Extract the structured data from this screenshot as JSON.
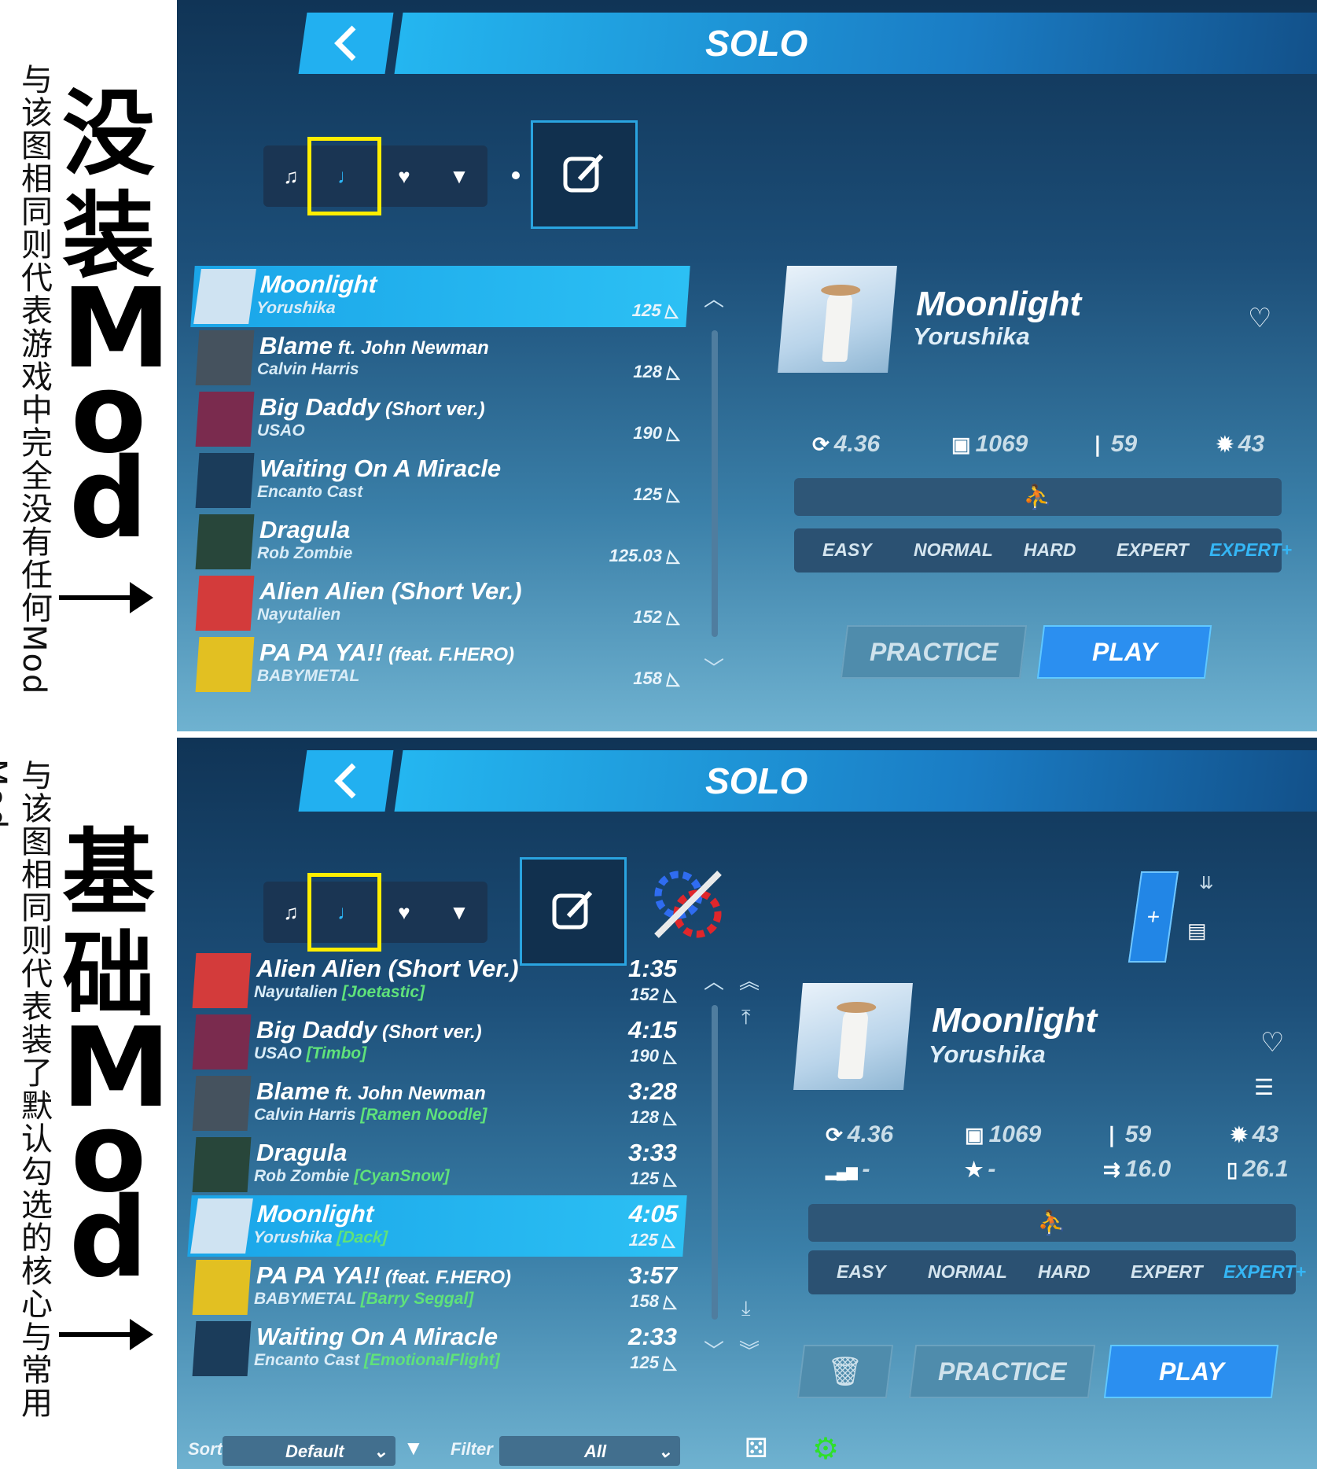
{
  "labels": {
    "top": {
      "small": "与该图相同则代表游戏中完全没有任何Mod",
      "big_cn": [
        "没",
        "装"
      ],
      "big_lat": [
        "M",
        "o",
        "d"
      ]
    },
    "bottom": {
      "small": "与该图相同则代表装了默认勾选的核心与常用Mod",
      "big_cn": [
        "基",
        "础"
      ],
      "big_lat": [
        "M",
        "o",
        "d"
      ]
    }
  },
  "top": {
    "title": "SOLO",
    "songs": [
      {
        "title": "Moonlight",
        "title_sub": "",
        "artist": "Yorushika",
        "bpm": "125",
        "selected": true,
        "cover": "#cfe3f2"
      },
      {
        "title": "Blame",
        "title_sub": " ft. John Newman",
        "artist": "Calvin Harris",
        "bpm": "128",
        "selected": false,
        "cover": "#45525e"
      },
      {
        "title": "Big Daddy",
        "title_sub": " (Short ver.)",
        "artist": "USAO",
        "bpm": "190",
        "selected": false,
        "cover": "#7a2b4e"
      },
      {
        "title": "Waiting On A Miracle",
        "title_sub": "",
        "artist": "Encanto Cast",
        "bpm": "125",
        "selected": false,
        "cover": "#1b3c5a"
      },
      {
        "title": "Dragula",
        "title_sub": "",
        "artist": "Rob Zombie",
        "bpm": "125.03",
        "selected": false,
        "cover": "#28463a"
      },
      {
        "title": "Alien Alien (Short Ver.)",
        "title_sub": "",
        "artist": "Nayutalien",
        "bpm": "152",
        "selected": false,
        "cover": "#d33b3b"
      },
      {
        "title": "PA PA YA!!",
        "title_sub": " (feat. F.HERO)",
        "artist": "BABYMETAL",
        "bpm": "158",
        "selected": false,
        "cover": "#e2c022"
      }
    ],
    "detail": {
      "title": "Moonlight",
      "artist": "Yorushika",
      "stats": [
        {
          "icon": "njs-icon",
          "glyph": "⟳",
          "value": "4.36"
        },
        {
          "icon": "notes-icon",
          "glyph": "▣",
          "value": "1069"
        },
        {
          "icon": "walls-icon",
          "glyph": "❘",
          "value": "59"
        },
        {
          "icon": "bombs-icon",
          "glyph": "✹",
          "value": "43"
        }
      ],
      "difficulties": [
        "EASY",
        "NORMAL",
        "HARD",
        "EXPERT",
        "EXPERT+"
      ],
      "active_difficulty": "EXPERT+",
      "practice_label": "PRACTICE",
      "play_label": "PLAY"
    }
  },
  "bottom": {
    "title": "SOLO",
    "songs": [
      {
        "title": "Alien Alien (Short Ver.)",
        "title_sub": "",
        "artist": "Nayutalien",
        "mapper": "Joetastic",
        "duration": "1:35",
        "bpm": "152",
        "selected": false,
        "cover": "#d33b3b"
      },
      {
        "title": "Big Daddy",
        "title_sub": " (Short ver.)",
        "artist": "USAO",
        "mapper": "Timbo",
        "duration": "4:15",
        "bpm": "190",
        "selected": false,
        "cover": "#7a2b4e"
      },
      {
        "title": "Blame",
        "title_sub": " ft. John Newman",
        "artist": "Calvin Harris",
        "mapper": "Ramen Noodle",
        "duration": "3:28",
        "bpm": "128",
        "selected": false,
        "cover": "#45525e"
      },
      {
        "title": "Dragula",
        "title_sub": "",
        "artist": "Rob Zombie",
        "mapper": "CyanSnow",
        "duration": "3:33",
        "bpm": "125",
        "selected": false,
        "cover": "#28463a"
      },
      {
        "title": "Moonlight",
        "title_sub": "",
        "artist": "Yorushika",
        "mapper": "Dack",
        "duration": "4:05",
        "bpm": "125",
        "selected": true,
        "cover": "#cfe3f2"
      },
      {
        "title": "PA PA YA!!",
        "title_sub": " (feat. F.HERO)",
        "artist": "BABYMETAL",
        "mapper": "Barry Seggal",
        "duration": "3:57",
        "bpm": "158",
        "selected": false,
        "cover": "#e2c022"
      },
      {
        "title": "Waiting On A Miracle",
        "title_sub": "",
        "artist": "Encanto Cast",
        "mapper": "EmotionalFlight",
        "duration": "2:33",
        "bpm": "125",
        "selected": false,
        "cover": "#1b3c5a"
      }
    ],
    "detail": {
      "title": "Moonlight",
      "artist": "Yorushika",
      "stats": [
        {
          "icon": "njs-icon",
          "glyph": "⟳",
          "value": "4.36"
        },
        {
          "icon": "notes-icon",
          "glyph": "▣",
          "value": "1069"
        },
        {
          "icon": "walls-icon",
          "glyph": "❘",
          "value": "59"
        },
        {
          "icon": "bombs-icon",
          "glyph": "✹",
          "value": "43"
        },
        {
          "icon": "signal-icon",
          "glyph": "▂▄▆",
          "value": "-"
        },
        {
          "icon": "star-icon",
          "glyph": "★",
          "value": "-"
        },
        {
          "icon": "speed-icon",
          "glyph": "⇉",
          "value": "16.0"
        },
        {
          "icon": "ruler-icon",
          "glyph": "▯",
          "value": "26.1"
        }
      ],
      "difficulties": [
        "EASY",
        "NORMAL",
        "HARD",
        "EXPERT",
        "EXPERT+"
      ],
      "active_difficulty": "EXPERT+",
      "practice_label": "PRACTICE",
      "play_label": "PLAY"
    },
    "sort_label": "Sort",
    "sort_value": "Default",
    "filter_label": "Filter",
    "filter_value": "All"
  },
  "colors": {
    "accent": "#22b0f0",
    "highlight_box": "#ffee00",
    "mapper": "#5fe27a",
    "settings": "#2ee02a"
  }
}
